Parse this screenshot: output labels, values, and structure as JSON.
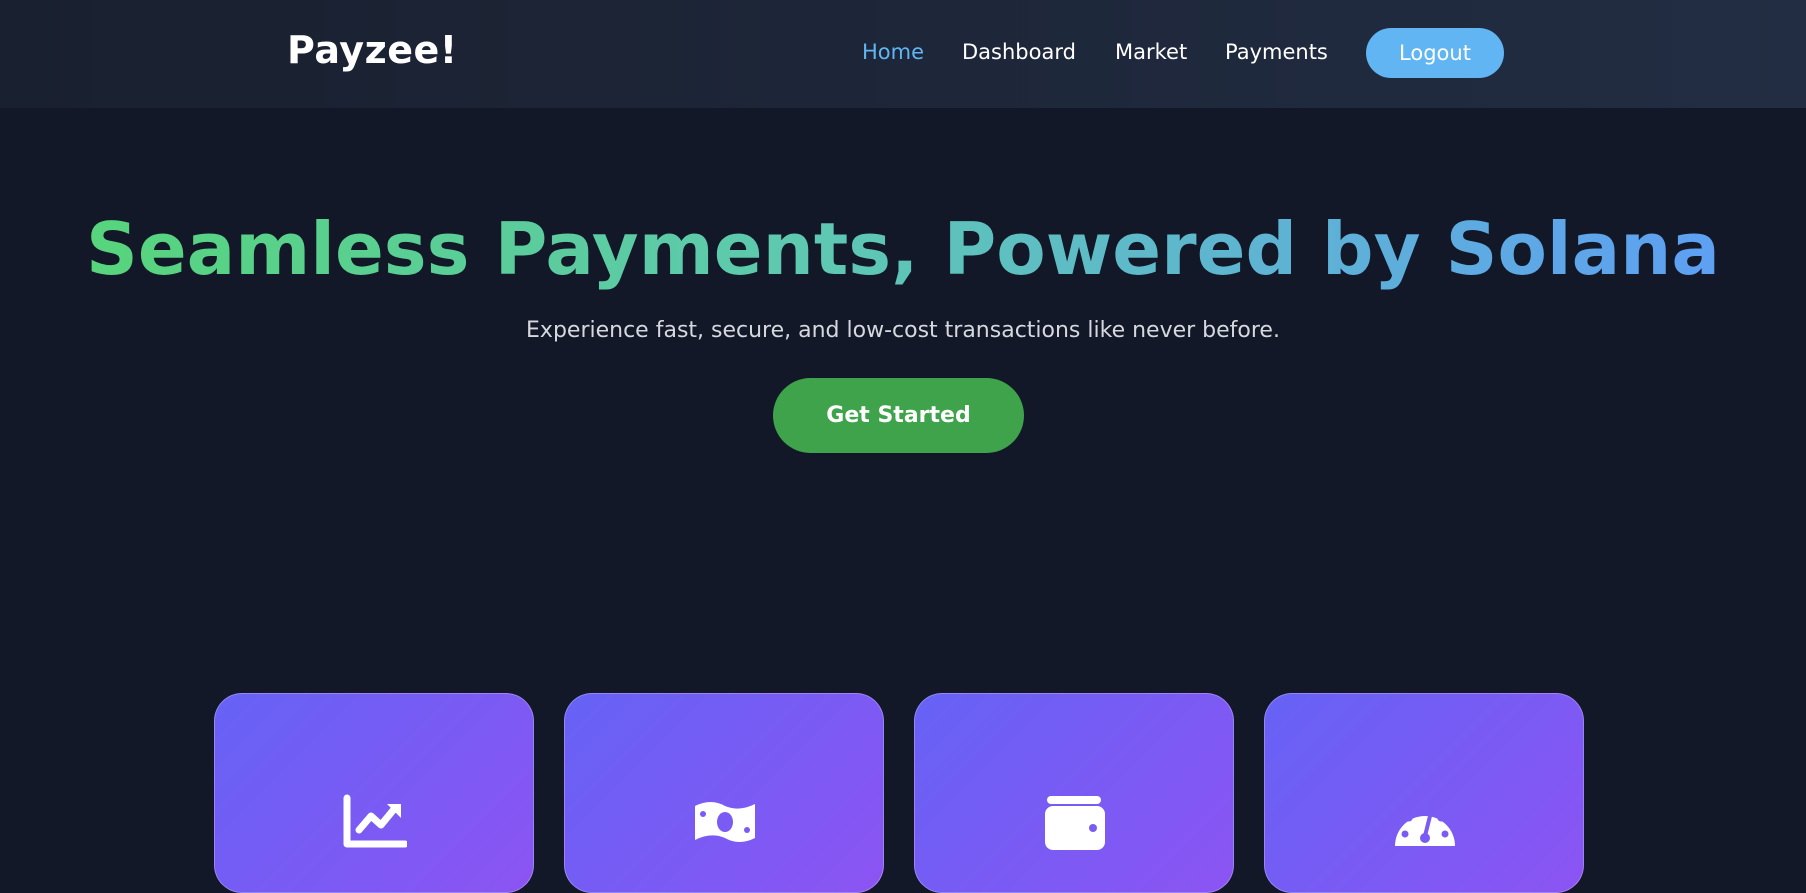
{
  "navbar": {
    "brand": "Payzee!",
    "links": [
      {
        "label": "Home",
        "active": true
      },
      {
        "label": "Dashboard",
        "active": false
      },
      {
        "label": "Market",
        "active": false
      },
      {
        "label": "Payments",
        "active": false
      }
    ],
    "logout_label": "Logout"
  },
  "hero": {
    "title": "Seamless Payments, Powered by Solana",
    "subtitle": "Experience fast, secure, and low-cost transactions like never before.",
    "cta_label": "Get Started"
  },
  "features": [
    {
      "icon": "chart-line-icon"
    },
    {
      "icon": "money-bill-icon"
    },
    {
      "icon": "wallet-icon"
    },
    {
      "icon": "gauge-icon"
    }
  ],
  "colors": {
    "background": "#121827",
    "accent_blue": "#60b5f2",
    "cta_green": "#3fa34b",
    "card_gradient_start": "#6662f5",
    "card_gradient_end": "#8c54f3"
  }
}
